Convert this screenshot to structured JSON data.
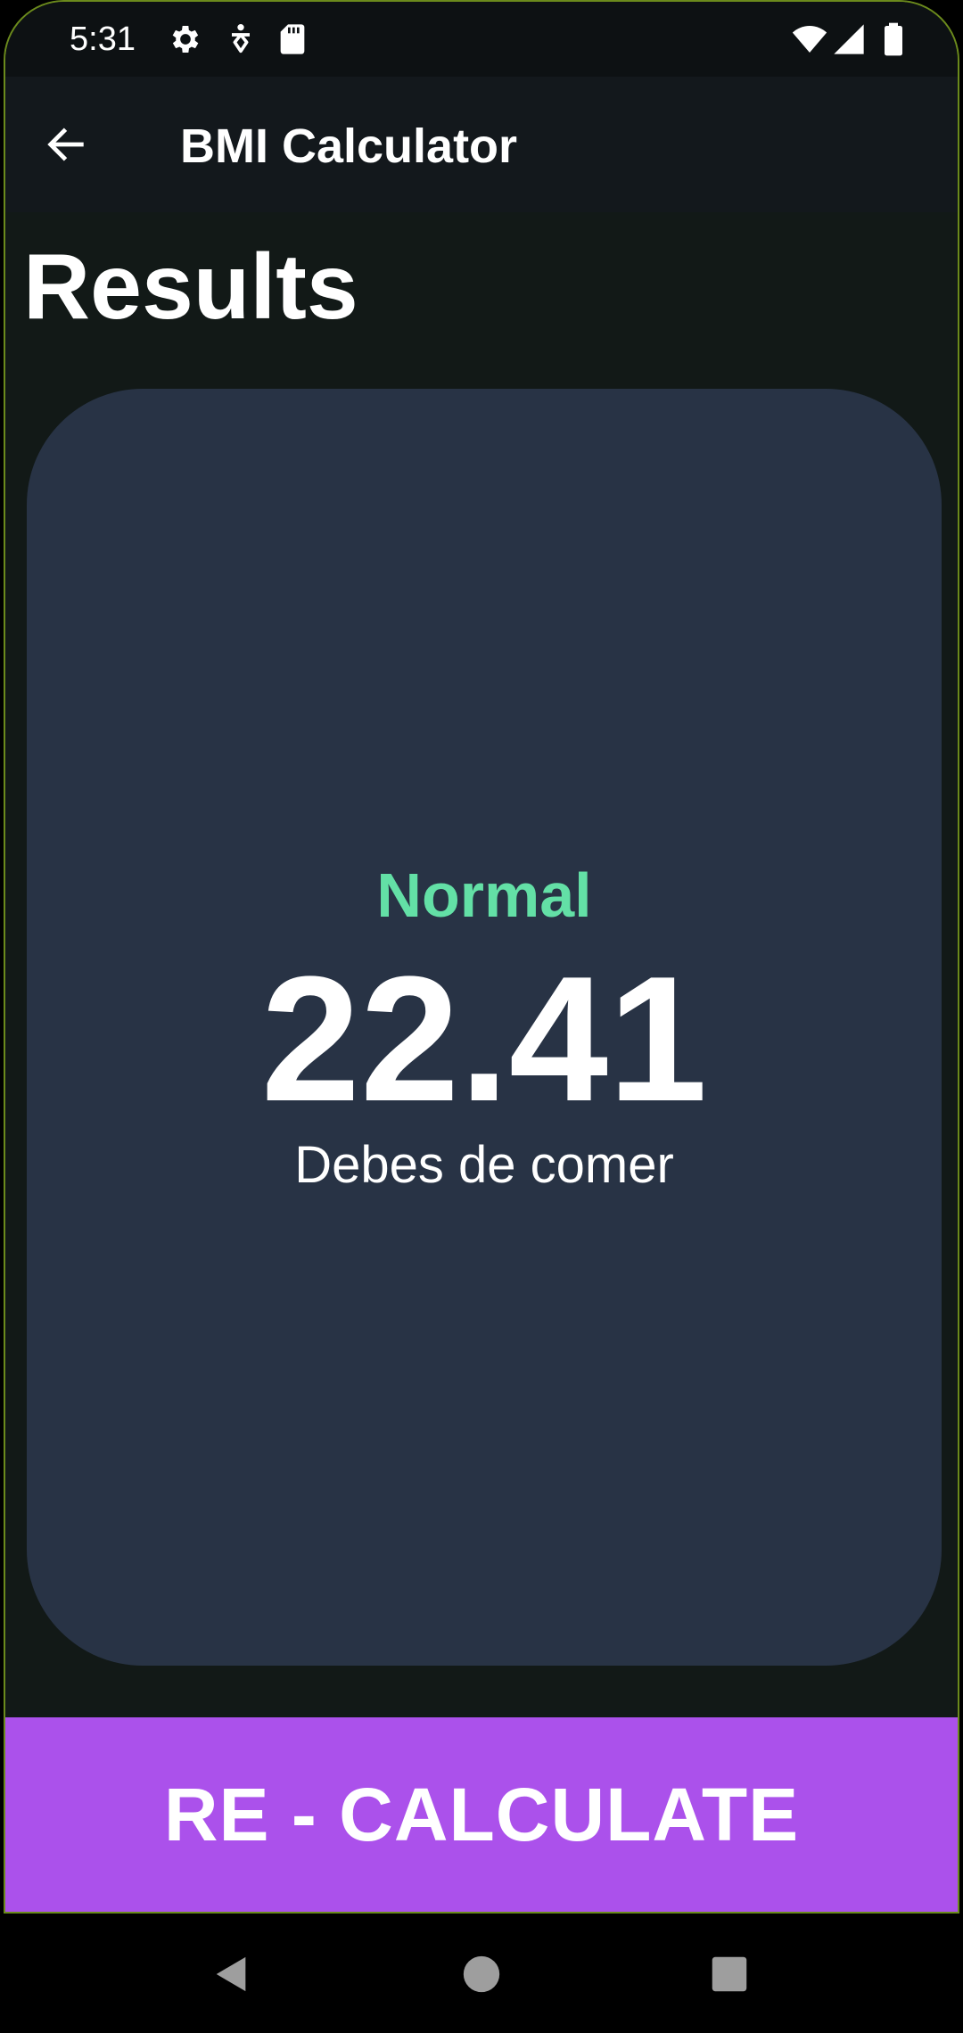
{
  "status_bar": {
    "time": "5:31",
    "left_icons": [
      "gear-icon",
      "accessibility-icon",
      "sd-card-icon"
    ],
    "right_icons": [
      "wifi-icon",
      "cell-signal-icon",
      "battery-icon"
    ]
  },
  "app_bar": {
    "back_icon": "arrow-left-icon",
    "title": "BMI Calculator"
  },
  "page": {
    "title": "Results"
  },
  "result": {
    "status": "Normal",
    "value": "22.41",
    "message": "Debes de comer"
  },
  "actions": {
    "recalculate_label": "RE - CALCULATE"
  },
  "nav_bar": {
    "icons": [
      "back-triangle-icon",
      "home-circle-icon",
      "recents-square-icon"
    ]
  },
  "colors": {
    "background": "#121917",
    "card": "#283345",
    "status_accent": "#63e0a6",
    "button": "#ab51eb"
  }
}
